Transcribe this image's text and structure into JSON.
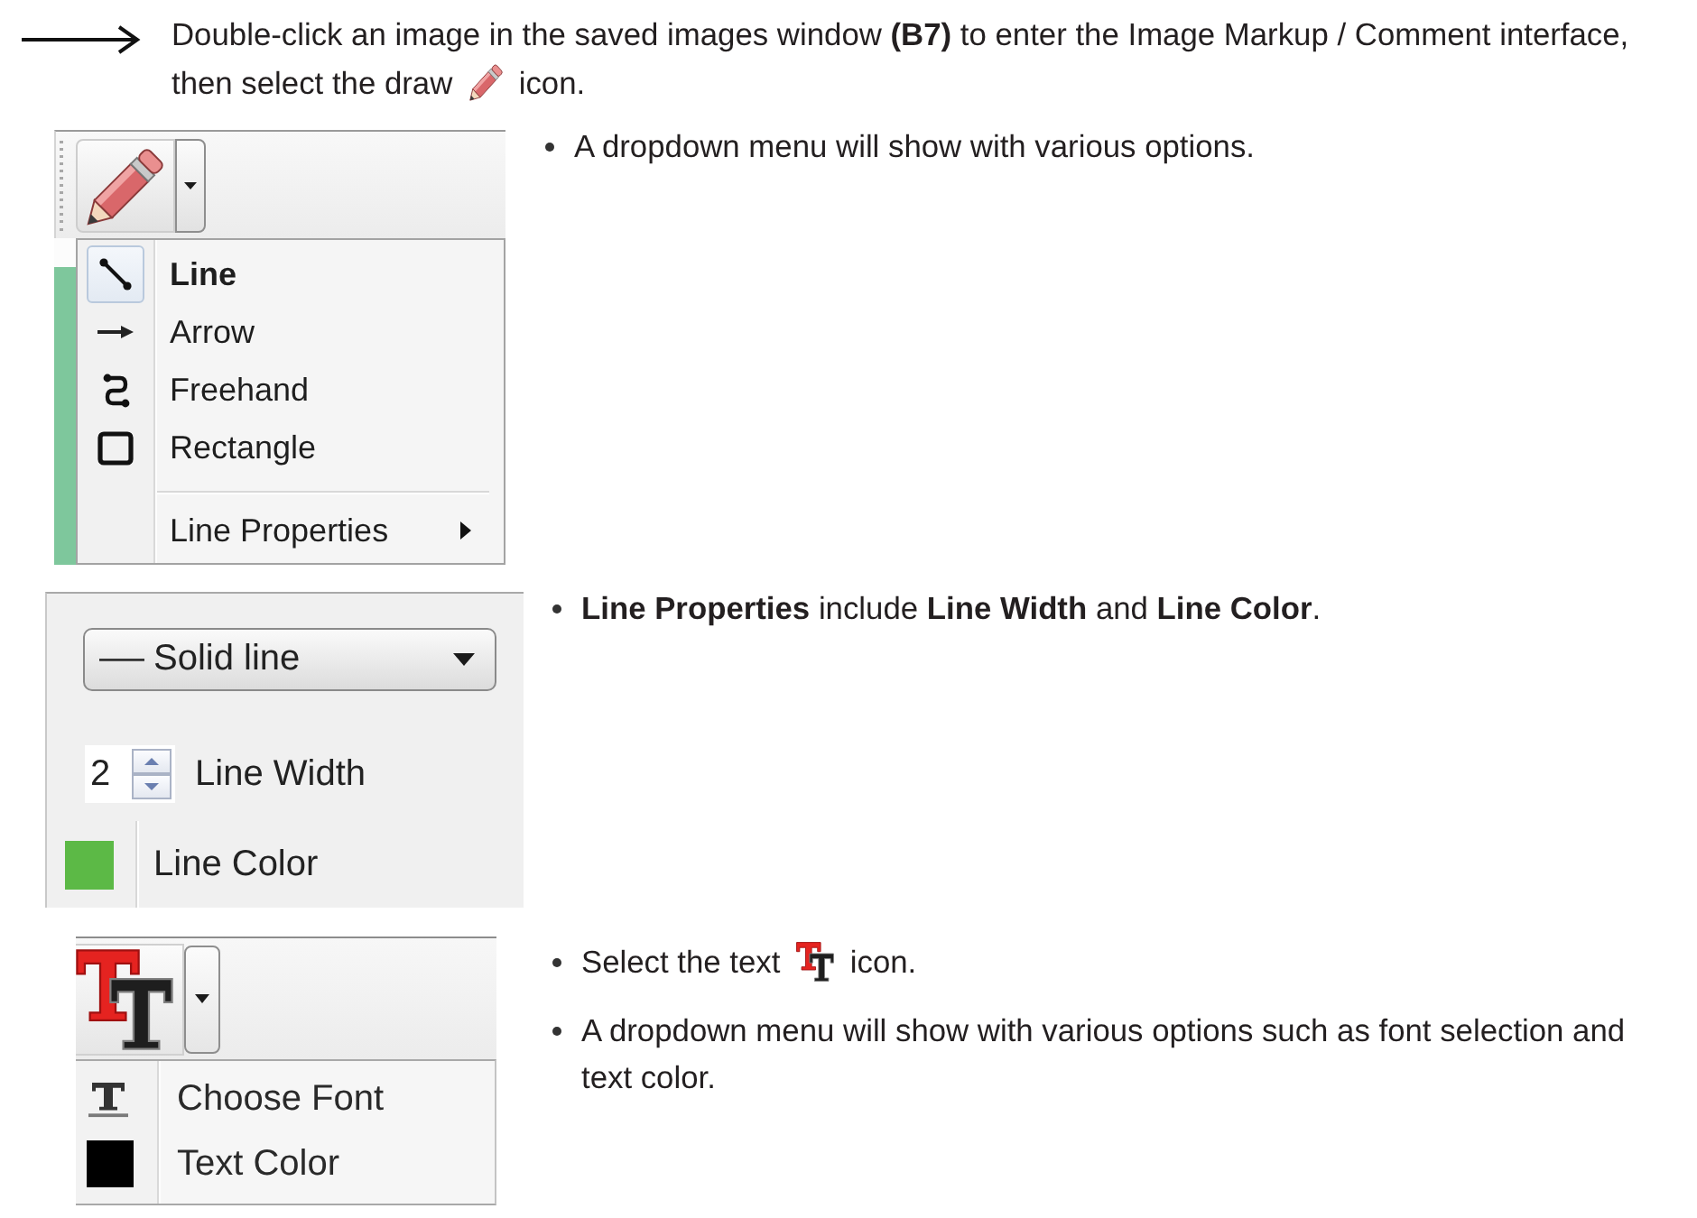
{
  "instruction": {
    "lines": [
      "Double-click an image in the saved images window **(B7)** to enter the Image Markup / Comment interface,",
      "then select the draw"
    ],
    "text_after": "icon."
  },
  "sections": [
    {
      "kind": "draw_menu",
      "inset": {
        "items": [
          {
            "kind": "line",
            "label": "Line",
            "selected": true
          },
          {
            "kind": "arrow",
            "label": "Arrow",
            "selected": false
          },
          {
            "kind": "freehand",
            "label": "Freehand",
            "selected": false
          },
          {
            "kind": "rectangle",
            "label": "Rectangle",
            "selected": false
          }
        ],
        "submenu": {
          "label": "Line Properties"
        }
      },
      "bullets": [
        {
          "kind": "plain",
          "text": "A dropdown menu will show with various options."
        }
      ]
    },
    {
      "kind": "line_properties",
      "inset": {
        "line_style": {
          "value": "Solid line"
        },
        "line_width": {
          "value": "2",
          "label": "Line Width"
        },
        "line_color": {
          "label": "Line Color",
          "color": "#5cb946"
        }
      },
      "bullets": [
        {
          "kind": "plain",
          "text": "**Line Properties** include **Line Width** and **Line Color**."
        }
      ]
    },
    {
      "kind": "text_menu",
      "inset": {
        "items": [
          {
            "kind": "font",
            "label": "Choose Font"
          },
          {
            "kind": "color",
            "label": "Text Color",
            "color": "#000000"
          }
        ]
      },
      "bullets": [
        {
          "kind": "inline_icon",
          "text": "Select the text",
          "text_after": "icon."
        },
        {
          "kind": "plain",
          "text": "A dropdown menu will show with various options such as font selection and text color."
        }
      ]
    }
  ]
}
